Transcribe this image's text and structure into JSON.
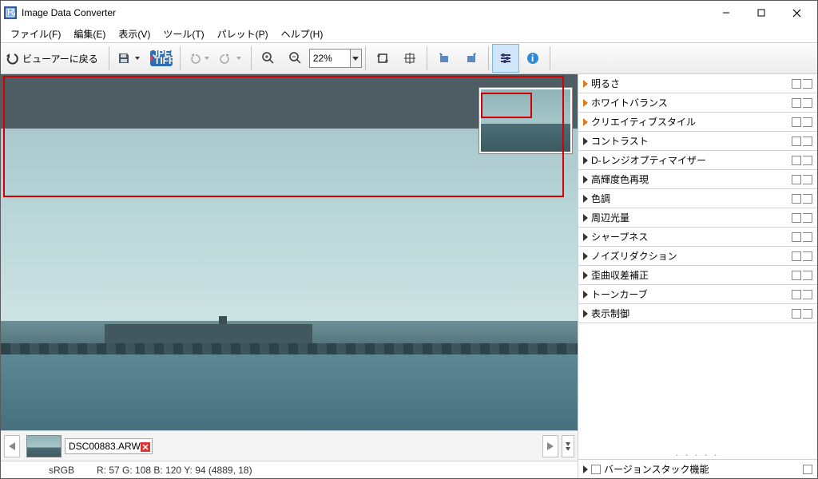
{
  "app": {
    "title": "Image Data Converter"
  },
  "menu": {
    "file": "ファイル(F)",
    "edit": "編集(E)",
    "view": "表示(V)",
    "tool": "ツール(T)",
    "palette": "パレット(P)",
    "help": "ヘルプ(H)"
  },
  "toolbar": {
    "back_label": "ビューアーに戻る",
    "zoom_value": "22%"
  },
  "panels": {
    "items": [
      {
        "label": "明るさ",
        "modified": true
      },
      {
        "label": "ホワイトバランス",
        "modified": true
      },
      {
        "label": "クリエイティブスタイル",
        "modified": true
      },
      {
        "label": "コントラスト",
        "modified": false
      },
      {
        "label": "D-レンジオプティマイザー",
        "modified": false
      },
      {
        "label": "高輝度色再現",
        "modified": false
      },
      {
        "label": "色調",
        "modified": false
      },
      {
        "label": "周辺光量",
        "modified": false
      },
      {
        "label": "シャープネス",
        "modified": false
      },
      {
        "label": "ノイズリダクション",
        "modified": false
      },
      {
        "label": "歪曲収差補正",
        "modified": false
      },
      {
        "label": "トーンカーブ",
        "modified": false
      },
      {
        "label": "表示制御",
        "modified": false
      }
    ],
    "version_stack": "バージョンスタック機能"
  },
  "film": {
    "filename": "DSC00883.ARW"
  },
  "status": {
    "colorspace": "sRGB",
    "readout": "R: 57  G: 108  B: 120  Y: 94    (4889,  18)"
  }
}
